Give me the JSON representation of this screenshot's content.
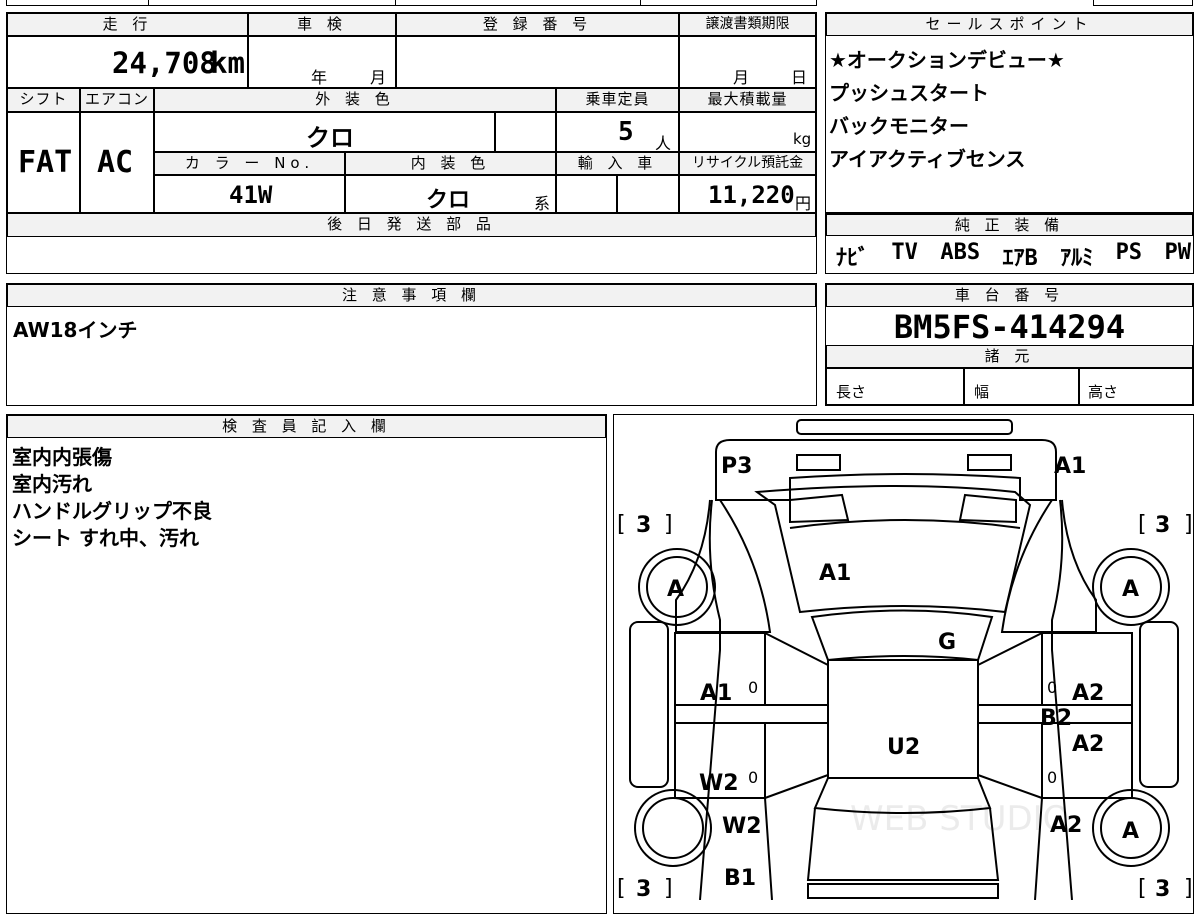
{
  "info": {
    "mileage_label": "走 行",
    "mileage_value": "24,708",
    "mileage_unit": "km",
    "inspection_label": "車 検",
    "inspection_year": "年",
    "inspection_month": "月",
    "registration_label": "登 録 番 号",
    "transfer_label": "譲渡書類期限",
    "transfer_month": "月",
    "transfer_day": "日",
    "shift_label": "シフト",
    "shift_value": "FAT",
    "ac_label": "エアコン",
    "ac_value": "AC",
    "exterior_label": "外 装 色",
    "exterior_value": "クロ",
    "capacity_label": "乗車定員",
    "capacity_value": "5",
    "capacity_unit": "人",
    "maxload_label": "最大積載量",
    "maxload_unit": "kg",
    "colorno_label": "カ ラ ー No.",
    "colorno_value": "41W",
    "interior_label": "内 装 色",
    "interior_value": "クロ",
    "interior_suffix": "系",
    "import_label": "輸 入 車",
    "recycle_label": "リサイクル預託金",
    "recycle_value": "11,220",
    "recycle_unit": "円",
    "later_parts_label": "後 日 発 送 部 品"
  },
  "sales": {
    "header": "セールスポイント",
    "points": [
      "★オークションデビュー★",
      "プッシュスタート",
      "バックモニター",
      "アイアクティブセンス"
    ]
  },
  "equipment": {
    "header": "純 正 装 備",
    "items": [
      "ﾅﾋﾞ",
      "TV",
      "ABS",
      "ｴｱB",
      "ｱﾙﾐ",
      "PS",
      "PW"
    ]
  },
  "notes": {
    "header": "注 意 事 項 欄",
    "text": "AW18インチ"
  },
  "chassis": {
    "header": "車 台 番 号",
    "value": "BM5FS-414294",
    "spec_header": "諸 元",
    "length_label": "長さ",
    "width_label": "幅",
    "height_label": "高さ"
  },
  "inspector": {
    "header": "検 査 員 記 入 欄",
    "lines": [
      "室内内張傷",
      "室内汚れ",
      "ハンドルグリップ不良",
      "シート すれ中、汚れ"
    ]
  },
  "diagram": {
    "marks": {
      "front_left": "P3",
      "front_right": "A1",
      "hood": "A1",
      "windshield": "G",
      "left_front_fender": "A1",
      "right_front_fender": "A2",
      "right_front_door": "B2",
      "right_front_door_2": "A2",
      "roof": "U2",
      "left_rear_door": "W2",
      "left_rear_fender": "W2",
      "right_rear_fender": "A2",
      "rear_left": "B1",
      "tire_fl": "A",
      "tire_fr": "A",
      "tire_rr": "A",
      "zero_1": "0",
      "zero_2": "0",
      "zero_3": "0",
      "zero_4": "0"
    },
    "tire_tread": {
      "fl": "3",
      "fr": "3",
      "rl": "3",
      "rr": "3"
    },
    "watermark": "WEB STUDIO"
  }
}
